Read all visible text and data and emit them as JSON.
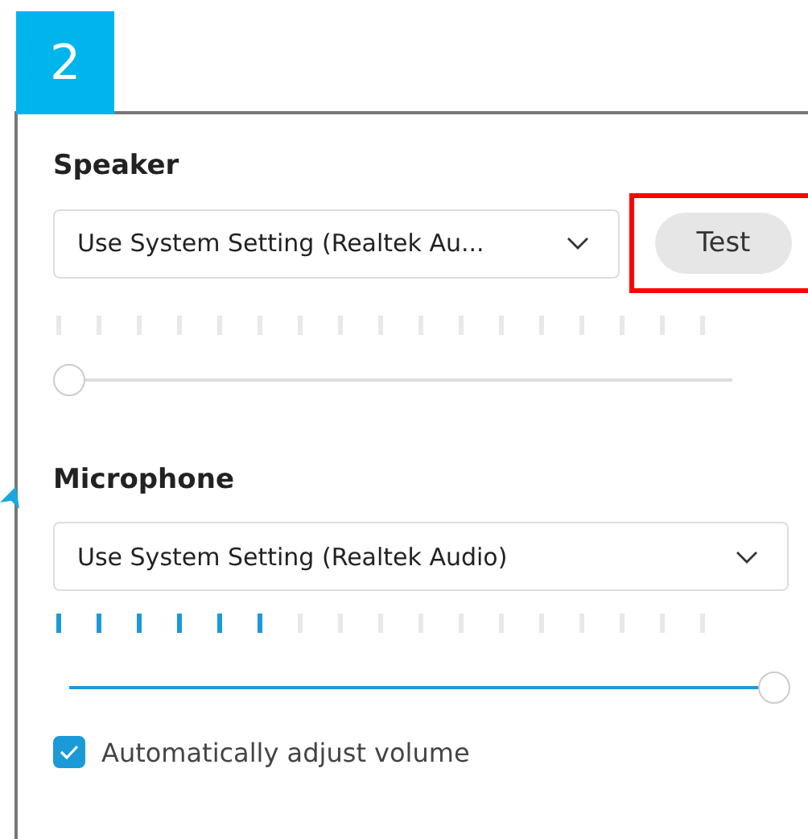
{
  "step_badge": "2",
  "speaker": {
    "label": "Speaker",
    "device": "Use System Setting (Realtek Au...",
    "test_button": "Test",
    "test_highlighted": true,
    "volume": {
      "level": 0
    }
  },
  "microphone": {
    "label": "Microphone",
    "device": "Use System Setting (Realtek Audio)",
    "meter": {
      "level": 0.35
    },
    "volume": {
      "level": 1
    },
    "auto_adjust": {
      "label": "Automatically adjust volume",
      "checked": true
    }
  }
}
